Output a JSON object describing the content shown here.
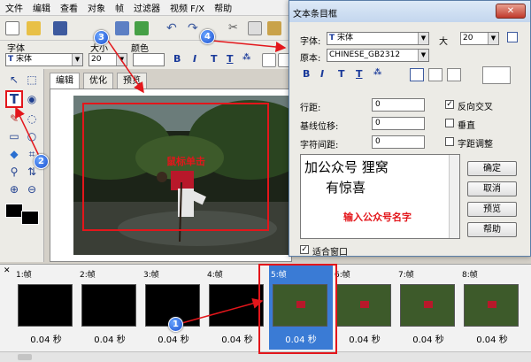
{
  "menu": [
    "文件",
    "编辑",
    "查看",
    "对象",
    "帧",
    "过滤器",
    "视频 F/X",
    "帮助"
  ],
  "propbar": {
    "font_label": "字体",
    "size_label": "大小",
    "color_label": "颜色",
    "font_value": "宋体",
    "size_value": "20"
  },
  "tabs": [
    "编辑",
    "优化",
    "预览"
  ],
  "canvas": {
    "annotation": "鼠标单击"
  },
  "dialog": {
    "title": "文本条目框",
    "font_label": "字体:",
    "font_value": "宋体",
    "size_label": "大",
    "size_value": "20",
    "script_label": "原本:",
    "script_value": "CHINESE_GB2312",
    "line_spacing_label": "行距:",
    "line_spacing_value": "0",
    "baseline_label": "基线位移:",
    "baseline_value": "0",
    "char_spacing_label": "字符间距:",
    "char_spacing_value": "0",
    "reverse_label": "反向交叉",
    "vertical_label": "垂直",
    "adjust_label": "字距调整",
    "text_line1": "加公众号 狸窝",
    "text_line2": "有惊喜",
    "input_hint": "输入公众号名字",
    "fit_window_label": "适合窗口",
    "buttons": [
      "确定",
      "取消",
      "预览",
      "帮助"
    ]
  },
  "frames": [
    {
      "label": "1:帧",
      "duration": "0.04 秒"
    },
    {
      "label": "2:帧",
      "duration": "0.04 秒"
    },
    {
      "label": "3:帧",
      "duration": "0.04 秒"
    },
    {
      "label": "4:帧",
      "duration": "0.04 秒"
    },
    {
      "label": "5:帧",
      "duration": "0.04 秒"
    },
    {
      "label": "6:帧",
      "duration": "0.04 秒"
    },
    {
      "label": "7:帧",
      "duration": "0.04 秒"
    },
    {
      "label": "8:帧",
      "duration": "0.04 秒"
    }
  ],
  "badges": [
    "1",
    "2",
    "3",
    "4"
  ],
  "colors": {
    "annotation_red": "#e3161b",
    "selection_blue": "#3a7bd5"
  }
}
